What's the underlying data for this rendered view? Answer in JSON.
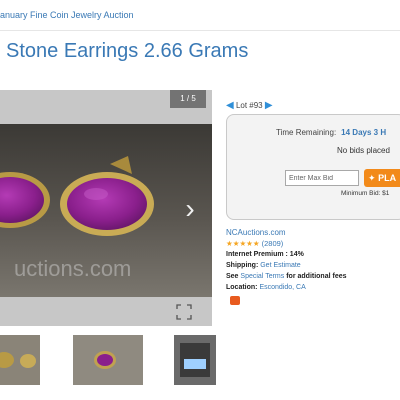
{
  "breadcrumb": "anuary Fine Coin Jewelry Auction",
  "title": "Stone Earrings 2.66 Grams",
  "viewer": {
    "counter": "1 / 5",
    "watermark": "uctions.com"
  },
  "lot": {
    "label": "Lot #93"
  },
  "bid": {
    "time_label": "Time Remaining:",
    "time_value": "14 Days 3 H",
    "status": "No bids placed",
    "max_bid_placeholder": "Enter Max Bid",
    "place_label": "PLA",
    "min_bid": "Minimum Bid: $1"
  },
  "seller": {
    "name": "NCAuctions.com",
    "stars": "★★★★★",
    "rating_count": "(2809)",
    "premium_label": "Internet Premium",
    "premium_value": ": 14%",
    "shipping_label": "Shipping:",
    "shipping_link": "Get Estimate",
    "see_text": "See",
    "terms_link": "Special Terms",
    "terms_suffix": "for additional fees",
    "location_label": "Location:",
    "location_value": "Escondido, CA"
  },
  "colors": {
    "link": "#3a79b5",
    "accent": "#f28a1a",
    "stone": "#8a1f8c",
    "gold": "#b89a45"
  }
}
